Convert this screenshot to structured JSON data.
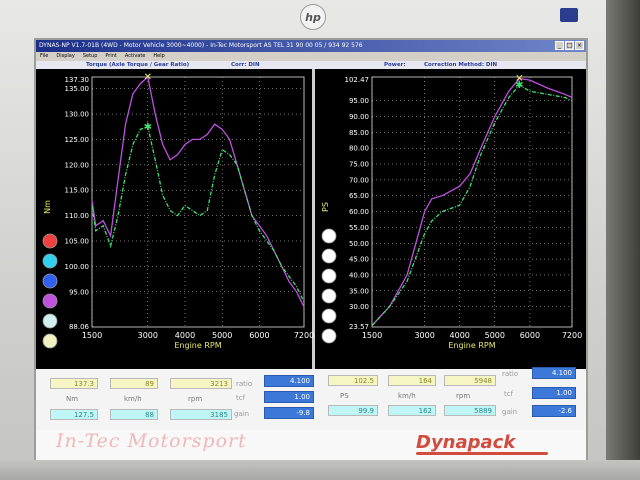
{
  "monitor": {
    "brand": "hp"
  },
  "window": {
    "title": "DYNAS-NP V1.7-01B   (4WD - Motor Vehicle 3000~4000) - In-Tec Motorsport AS TEL 31 90 00 05 / 934 92 576",
    "menu": [
      "File",
      "Display",
      "Setup",
      "Print",
      "Activate",
      "Help"
    ]
  },
  "header": {
    "left_title": "Torque (Axle Torque / Gear Ratio)",
    "left_corr": "Corr: DIN",
    "right_title": "Power:",
    "right_corr": "Correction Method: DIN"
  },
  "colors": {
    "purple_run": "#c050e0",
    "green_run": "#40e070",
    "plot_bg": "#000000",
    "grid": "#e0e0e0",
    "axis_text": "#ffffff"
  },
  "torque_chart": {
    "ylabel": "Nm",
    "xlabel": "Engine RPM",
    "ymax_label": "137.30",
    "ymin_label": "88.06",
    "yticks": [
      "135.00",
      "130.00",
      "125.00",
      "120.00",
      "115.00",
      "110.00",
      "105.00",
      "100.00",
      "95.00"
    ],
    "xticks": [
      "1500",
      "3000",
      "4000",
      "5000",
      "6000",
      "7200"
    ]
  },
  "power_chart": {
    "ylabel": "PS",
    "xlabel": "Engine RPM",
    "ymax_label": "102.47",
    "ymin_label": "23.57",
    "yticks": [
      "95.00",
      "90.00",
      "85.00",
      "80.00",
      "75.00",
      "70.00",
      "65.00",
      "60.00",
      "55.00",
      "50.00",
      "45.00",
      "40.00",
      "35.00",
      "30.00"
    ],
    "xticks": [
      "1500",
      "3000",
      "4000",
      "5000",
      "6000",
      "7200"
    ]
  },
  "chart_data": [
    {
      "type": "line",
      "ylabel": "Nm",
      "xlabel": "Engine RPM",
      "ylim": [
        88.06,
        137.3
      ],
      "xlim": [
        1500,
        7200
      ],
      "series": [
        {
          "color": "#c050e0",
          "x": [
            1500,
            1600,
            1800,
            2000,
            2200,
            2400,
            2600,
            2800,
            3000,
            3200,
            3400,
            3600,
            3800,
            4000,
            4200,
            4400,
            4600,
            4800,
            5000,
            5200,
            5400,
            5600,
            5800,
            6000,
            6200,
            6400,
            6600,
            6800,
            7000,
            7200
          ],
          "y": [
            113,
            108,
            109,
            106,
            117,
            128,
            134,
            136,
            137.3,
            130,
            124,
            121,
            122,
            124,
            125,
            125,
            126,
            128,
            127,
            125,
            120,
            115,
            110,
            108,
            106,
            103,
            100,
            97,
            95,
            92
          ]
        },
        {
          "color": "#40e070",
          "x": [
            1500,
            1600,
            1800,
            2000,
            2200,
            2400,
            2600,
            2800,
            3000,
            3200,
            3400,
            3600,
            3800,
            4000,
            4200,
            4400,
            4600,
            4800,
            5000,
            5200,
            5400,
            5600,
            5800,
            6000,
            6200,
            6400,
            6600,
            6800,
            7000,
            7200
          ],
          "y": [
            112,
            107,
            108,
            104,
            110,
            118,
            124,
            127,
            127.5,
            121,
            114,
            111,
            110,
            112,
            111,
            110,
            111,
            118,
            123,
            122,
            120,
            115,
            110,
            107,
            105,
            103,
            100,
            98,
            96,
            93
          ]
        }
      ]
    },
    {
      "type": "line",
      "ylabel": "PS",
      "xlabel": "Engine RPM",
      "ylim": [
        23.57,
        102.47
      ],
      "xlim": [
        1500,
        7200
      ],
      "series": [
        {
          "color": "#c050e0",
          "x": [
            1500,
            2000,
            2500,
            3000,
            3200,
            3500,
            4000,
            4300,
            4600,
            5000,
            5400,
            5700,
            6000,
            6500,
            7000,
            7200
          ],
          "y": [
            24,
            30,
            40,
            60,
            64,
            65,
            68,
            72,
            80,
            90,
            98,
            102,
            101.5,
            99,
            97,
            96
          ]
        },
        {
          "color": "#40e070",
          "x": [
            1500,
            2000,
            2500,
            3000,
            3200,
            3500,
            4000,
            4300,
            4600,
            5000,
            5400,
            5700,
            6000,
            6500,
            7000,
            7200
          ],
          "y": [
            24,
            30,
            38,
            53,
            57,
            60,
            62,
            68,
            78,
            88,
            96,
            99.9,
            98,
            97,
            96,
            95
          ]
        }
      ]
    }
  ],
  "panel": {
    "torque_top": "137.3",
    "kmh_top": "89",
    "rpm_top": "3213",
    "ratio_label": "ratio",
    "ratio_left": "4.100",
    "tcf_label": "tcf",
    "tcf_left": "1.00",
    "gain_label": "gain",
    "gain_left": "-9.8",
    "unit_nm": "Nm",
    "unit_kmh": "km/h",
    "unit_rpm": "rpm",
    "torque_bottom": "127.5",
    "kmh_bottom": "88",
    "rpm_bottom": "3185",
    "ps_top": "102.5",
    "kmh_top_r": "164",
    "rpm_top_r": "5948",
    "unit_ps": "PS",
    "ps_bottom": "99.9",
    "kmh_bottom_r": "162",
    "rpm_bottom_r": "5889",
    "ratio_right": "4.100",
    "tcf_right": "1.00",
    "gain_right": "-2.6"
  },
  "footer": {
    "left_logo": "In-Tec Motorsport",
    "right_logo": "Dynapack"
  }
}
